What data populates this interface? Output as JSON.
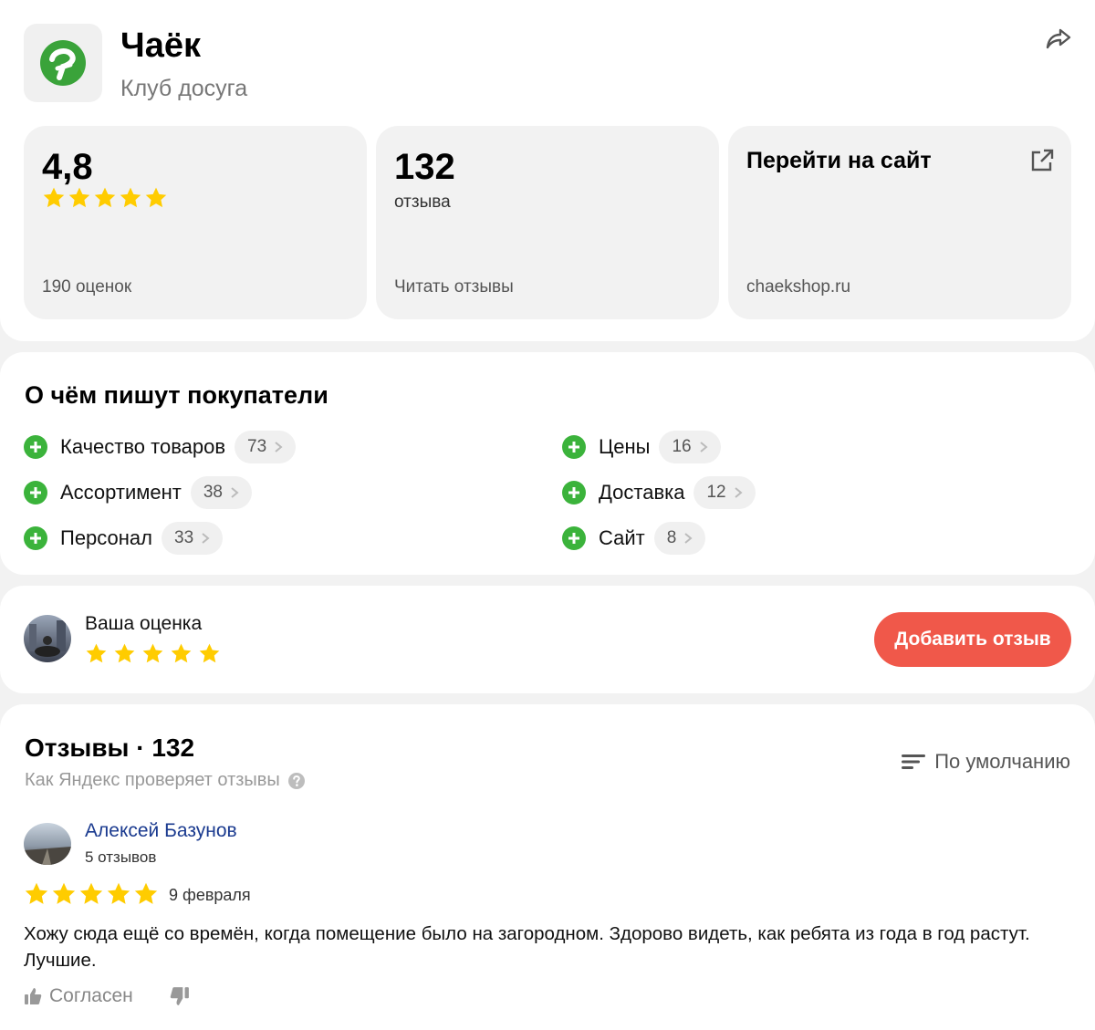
{
  "colors": {
    "accent_button": "#f0584a",
    "star": "#ffcc00",
    "positive": "#3bb33b",
    "author_link": "#1a3a8f"
  },
  "org": {
    "name": "Чаёк",
    "category": "Клуб досуга",
    "logo_icon": "chaek-logo-icon",
    "share_icon": "share-icon"
  },
  "tiles": {
    "rating": {
      "value": "4,8",
      "stars": 5,
      "footer": "190 оценок"
    },
    "reviews": {
      "value": "132",
      "sub": "отзыва",
      "footer": "Читать отзывы"
    },
    "site": {
      "title": "Перейти на сайт",
      "footer": "chaekshop.ru",
      "icon": "external-link-icon"
    }
  },
  "topics": {
    "title": "О чём пишут покупатели",
    "items": [
      {
        "label": "Качество товаров",
        "count": "73"
      },
      {
        "label": "Ассортимент",
        "count": "38"
      },
      {
        "label": "Персонал",
        "count": "33"
      },
      {
        "label": "Цены",
        "count": "16"
      },
      {
        "label": "Доставка",
        "count": "12"
      },
      {
        "label": "Сайт",
        "count": "8"
      }
    ]
  },
  "your_rating": {
    "label": "Ваша оценка",
    "stars": 5,
    "button": "Добавить отзыв"
  },
  "reviews": {
    "title": "Отзывы · 132",
    "check_link": "Как Яндекс проверяет отзывы",
    "sort_label": "По умолчанию",
    "items": [
      {
        "author": "Алексей Базунов",
        "author_reviews": "5 отзывов",
        "rating": 5,
        "date": "9 февраля",
        "text": "Хожу сюда ещё со времён, когда помещение было на загородном. Здорово видеть, как ребята из года в год растут. Лучшие.",
        "agree_label": "Согласен"
      }
    ]
  }
}
